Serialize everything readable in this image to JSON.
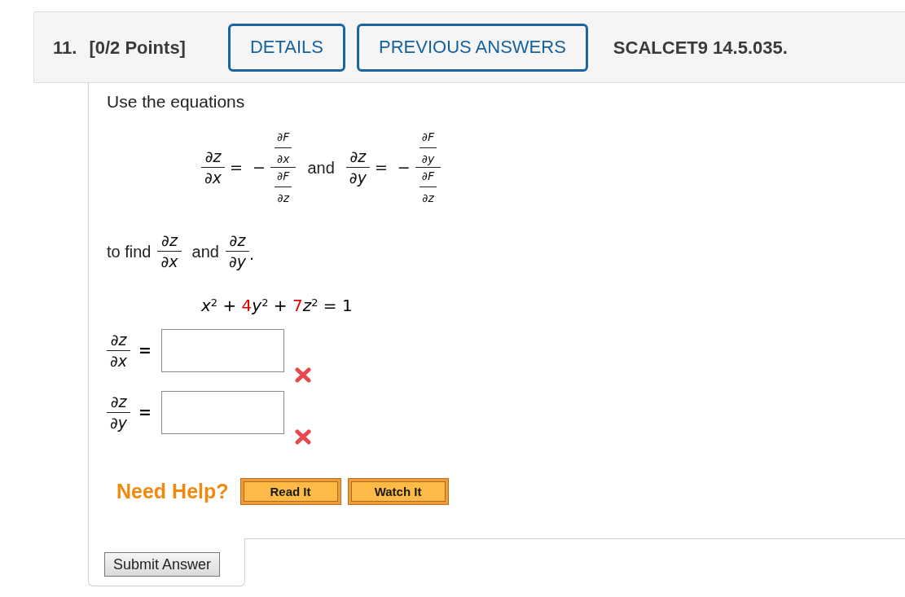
{
  "header": {
    "number": "11.",
    "points": "[0/2 Points]",
    "buttons": [
      {
        "label": "DETAILS"
      },
      {
        "label": "PREVIOUS ANSWERS"
      }
    ],
    "code": "SCALCET9 14.5.035."
  },
  "question": {
    "intro": "Use the equations",
    "formula": [
      {
        "kind": "frac",
        "num": "∂z",
        "den": "∂x"
      },
      {
        "kind": "op",
        "text": "="
      },
      {
        "kind": "op",
        "text": "−"
      },
      {
        "kind": "nested_frac",
        "num": {
          "num": "∂F",
          "den": "∂x"
        },
        "den": {
          "num": "∂F",
          "den": "∂z"
        }
      },
      {
        "kind": "word",
        "text": "and"
      },
      {
        "kind": "frac",
        "num": "∂z",
        "den": "∂y"
      },
      {
        "kind": "op",
        "text": "="
      },
      {
        "kind": "op",
        "text": "−"
      },
      {
        "kind": "nested_frac",
        "num": {
          "num": "∂F",
          "den": "∂y"
        },
        "den": {
          "num": "∂F",
          "den": "∂z"
        }
      }
    ],
    "task": [
      {
        "kind": "word",
        "text": "to find"
      },
      {
        "kind": "frac",
        "num": "∂z",
        "den": "∂x"
      },
      {
        "kind": "word",
        "text": "and"
      },
      {
        "kind": "frac",
        "num": "∂z",
        "den": "∂y"
      },
      {
        "kind": "punct",
        "text": "."
      }
    ],
    "equation": [
      {
        "text": "*x*$^{2}$ + ",
        "color": "#000000"
      },
      {
        "text": "4",
        "color": "#e00000"
      },
      {
        "text": "*y*$^{2}$ + ",
        "color": "#000000"
      },
      {
        "text": "7",
        "color": "#e00000"
      },
      {
        "text": "*z*$^{2}$ = 1",
        "color": "#000000"
      }
    ],
    "answers": [
      {
        "num": "∂z",
        "den": "∂x",
        "sign": "=",
        "correct": false
      },
      {
        "num": "∂z",
        "den": "∂y",
        "sign": "=",
        "correct": false
      }
    ]
  },
  "help": {
    "label": "Need Help?",
    "buttons": [
      {
        "label": "Read It"
      },
      {
        "label": "Watch It"
      }
    ]
  },
  "submit": {
    "label": "Submit Answer"
  }
}
